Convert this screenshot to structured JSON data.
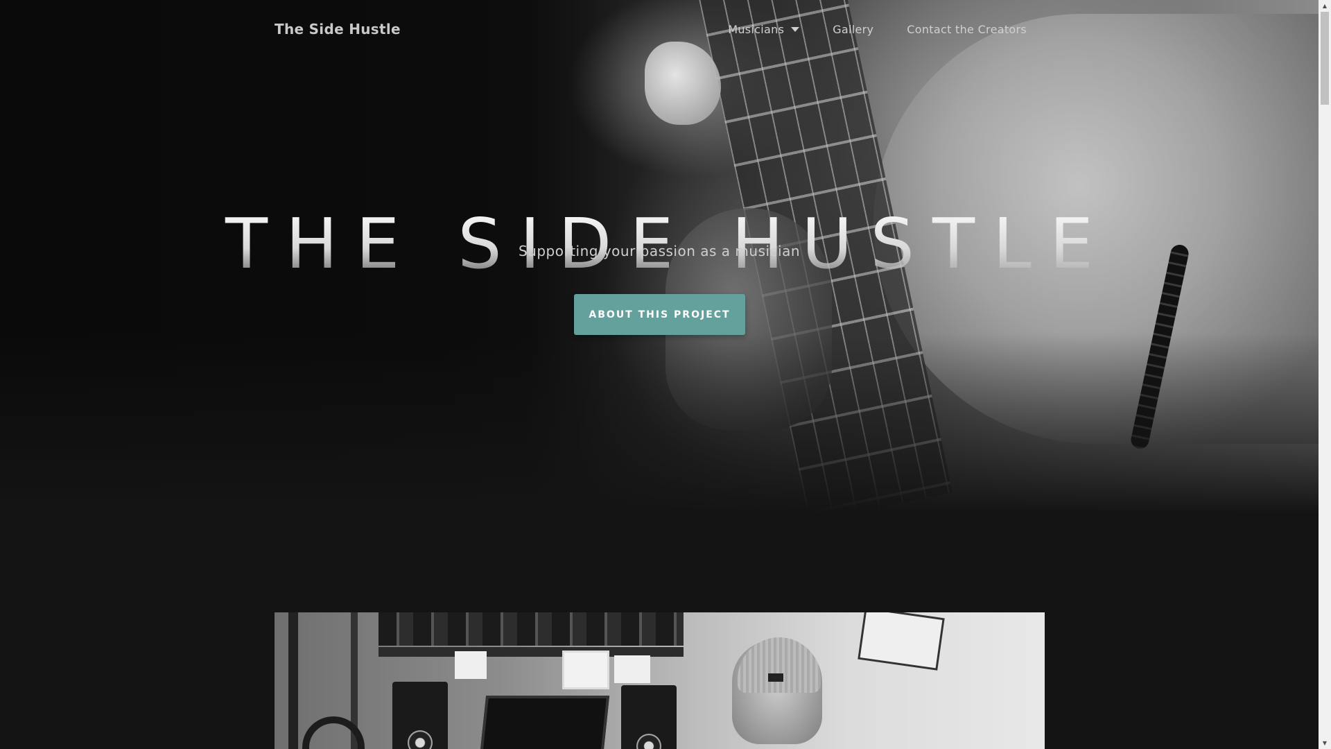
{
  "navbar": {
    "brand": "The Side Hustle",
    "items": [
      {
        "label": "Musicians",
        "has_dropdown": true
      },
      {
        "label": "Gallery",
        "has_dropdown": false
      },
      {
        "label": "Contact the Creators",
        "has_dropdown": false
      }
    ]
  },
  "hero": {
    "title": "THE SIDE HUSTLE",
    "subtitle": "Supporting your passion as a musician",
    "cta_label": "ABOUT THIS PROJECT"
  },
  "colors": {
    "accent": "#64a19d",
    "background": "#141414",
    "nav_text": "#d0d0d0"
  },
  "icons": {
    "dropdown": "caret-down-icon"
  }
}
